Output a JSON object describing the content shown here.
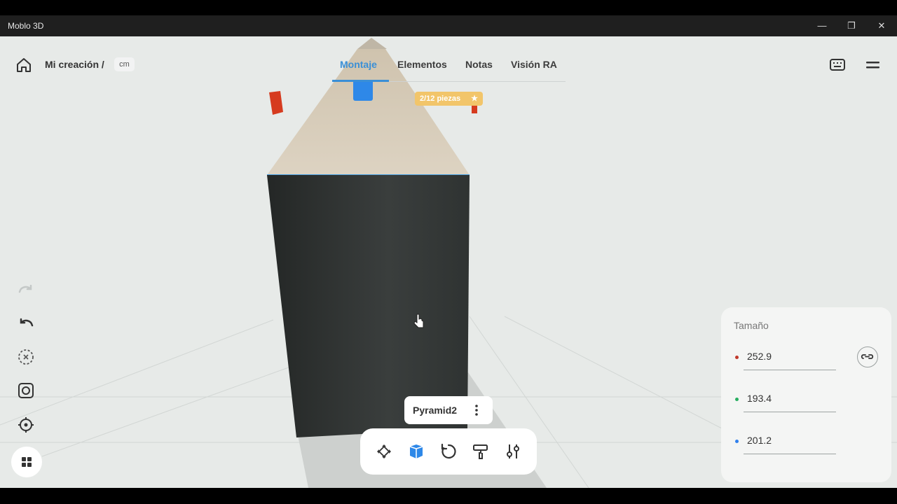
{
  "window": {
    "title": "Moblo 3D"
  },
  "header": {
    "breadcrumb": "Mi creación /",
    "unit": "cm"
  },
  "tabs": [
    {
      "label": "Montaje",
      "active": true
    },
    {
      "label": "Elementos",
      "active": false
    },
    {
      "label": "Notas",
      "active": false
    },
    {
      "label": "Visión RA",
      "active": false
    }
  ],
  "header_right": {
    "keyboard_icon": "keyboard-icon",
    "menu_icon": "menu-icon"
  },
  "left_tools": [
    "redo-icon",
    "undo-icon",
    "deselect-icon",
    "screenshot-icon",
    "recenter-icon",
    "grid-icon"
  ],
  "scene": {
    "pieces_badge": "2/12 piezas",
    "selected_object": "Pyramid2"
  },
  "toolbar": [
    "move-icon",
    "cube-color-icon",
    "rotate-icon",
    "paint-roller-icon",
    "sliders-icon"
  ],
  "size_panel": {
    "title": "Tamaño",
    "dimensions": [
      {
        "value": "252.9",
        "color": "#c0392b"
      },
      {
        "value": "193.4",
        "color": "#27ae60"
      },
      {
        "value": "201.2",
        "color": "#2f80ed"
      }
    ]
  },
  "colors": {
    "accent": "#3a8fd6",
    "badge": "#f2c56a"
  }
}
